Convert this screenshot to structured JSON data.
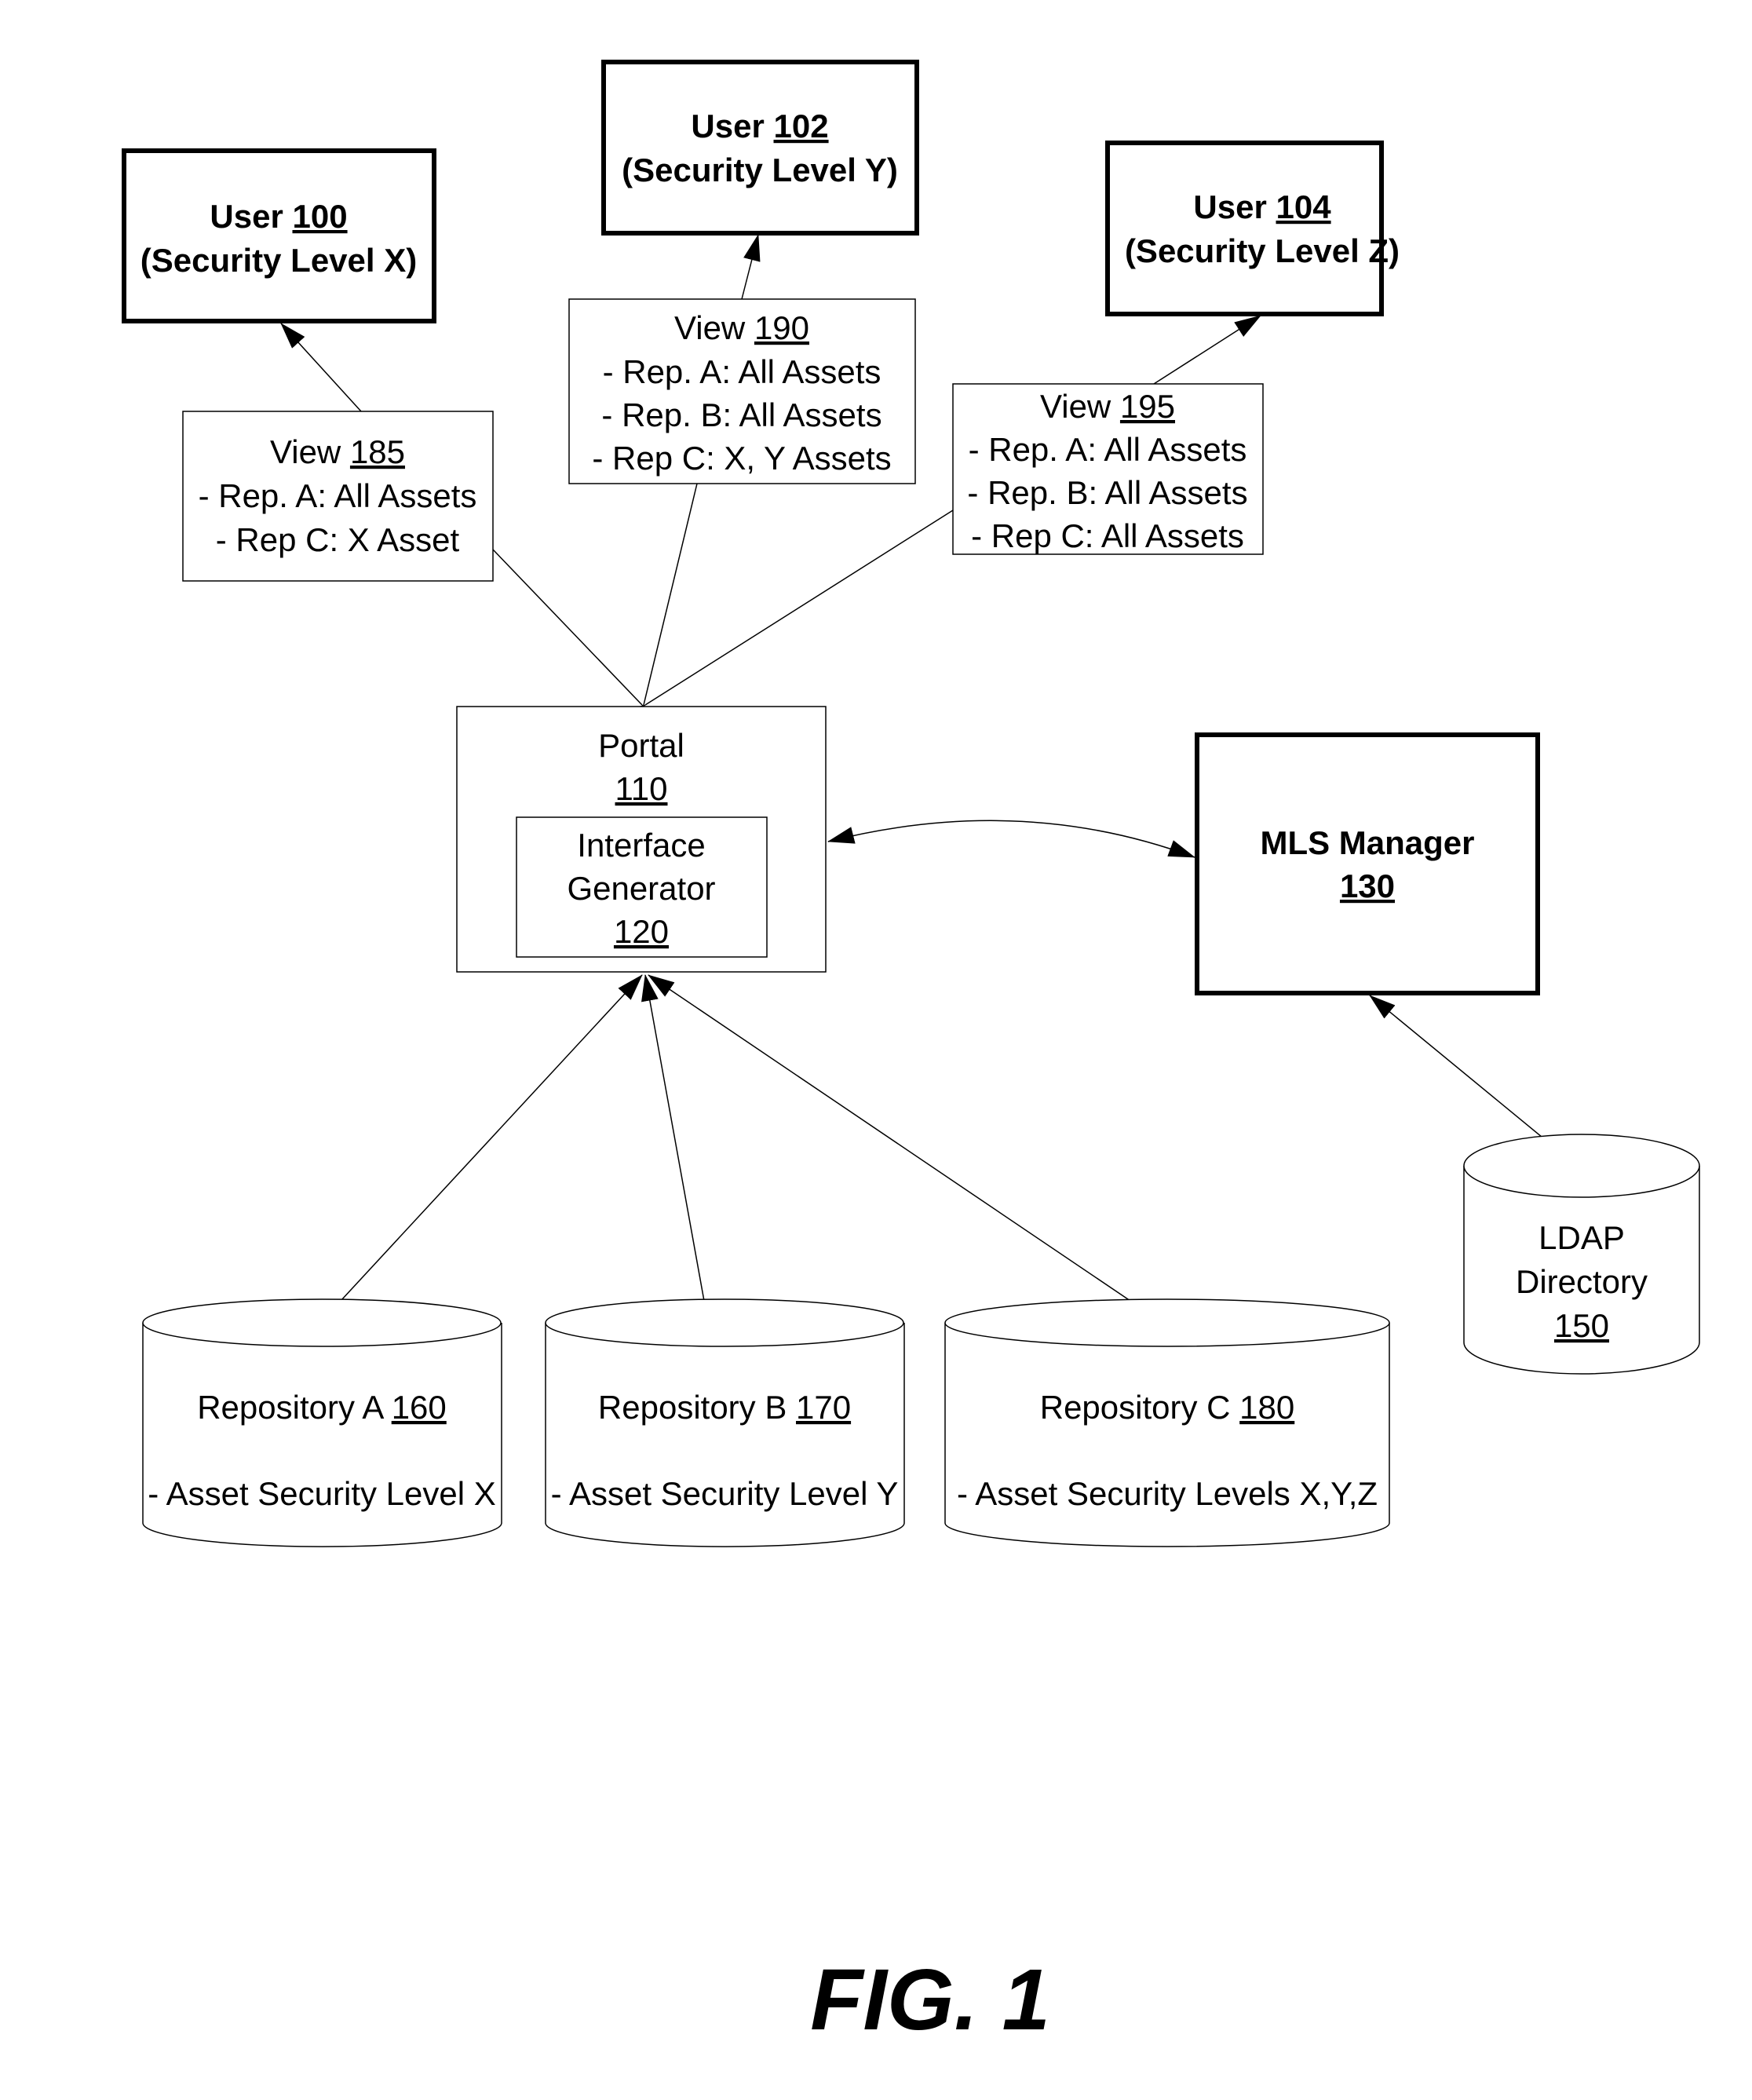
{
  "users": [
    {
      "id": "user-100",
      "label": "User",
      "ref": "100",
      "level": "(Security Level X)"
    },
    {
      "id": "user-102",
      "label": "User",
      "ref": "102",
      "level": "(Security Level Y)"
    },
    {
      "id": "user-104",
      "label": "User",
      "ref": "104",
      "level": "(Security Level Z)"
    }
  ],
  "views": [
    {
      "id": "view-185",
      "label": "View",
      "ref": "185",
      "lines": [
        "- Rep. A: All Assets",
        "- Rep C: X Asset"
      ]
    },
    {
      "id": "view-190",
      "label": "View",
      "ref": "190",
      "lines": [
        "- Rep. A: All Assets",
        "- Rep. B: All Assets",
        "- Rep C: X, Y Assets"
      ]
    },
    {
      "id": "view-195",
      "label": "View",
      "ref": "195",
      "lines": [
        "- Rep. A: All Assets",
        "- Rep. B: All Assets",
        "- Rep C: All Assets"
      ]
    }
  ],
  "portal": {
    "label": "Portal",
    "ref": "110",
    "interface_generator": {
      "line1": "Interface",
      "line2": "Generator",
      "ref": "120"
    }
  },
  "mls_manager": {
    "label": "MLS Manager",
    "ref": "130"
  },
  "ldap": {
    "line1": "LDAP",
    "line2": "Directory",
    "ref": "150"
  },
  "repositories": [
    {
      "id": "repo-a",
      "label": "Repository A",
      "ref": "160",
      "desc": "- Asset Security Level X"
    },
    {
      "id": "repo-b",
      "label": "Repository B",
      "ref": "170",
      "desc": "- Asset Security Level Y"
    },
    {
      "id": "repo-c",
      "label": "Repository C",
      "ref": "180",
      "desc": "- Asset Security Levels X,Y,Z"
    }
  ],
  "figure_label": "FIG. 1"
}
